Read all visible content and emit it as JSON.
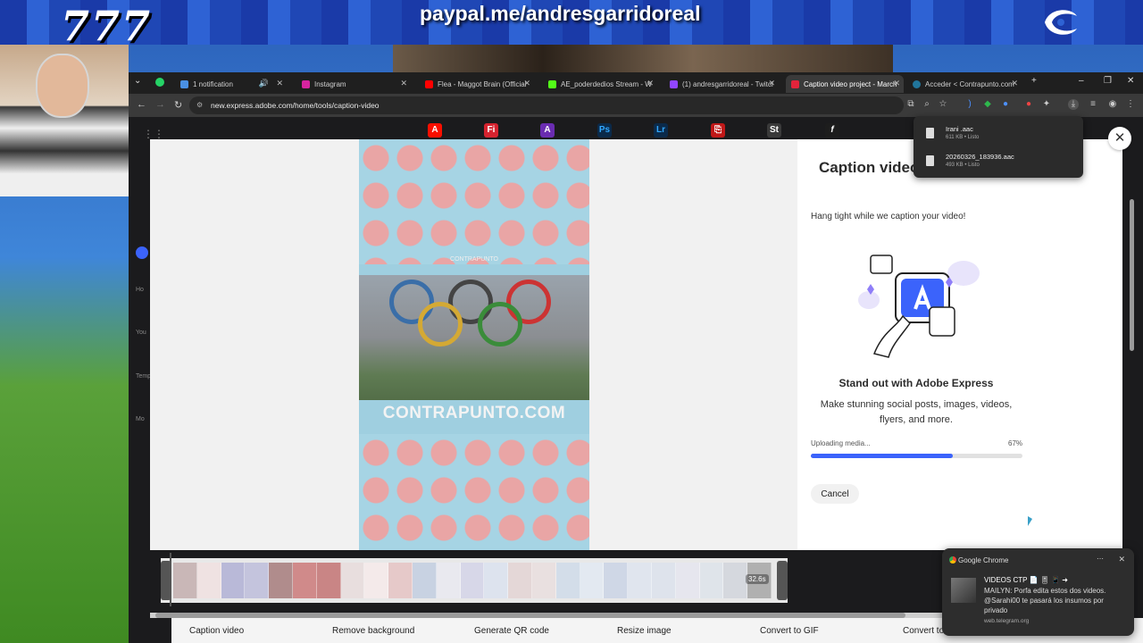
{
  "overlay": {
    "left_text": "777",
    "center_text": "paypal.me/andresgarridoreal"
  },
  "browser": {
    "tabs": [
      {
        "label": "1 notification",
        "fav": "#4a90e2"
      },
      {
        "label": "Instagram",
        "fav": "#d6249f"
      },
      {
        "label": "Flea - Maggot Brain (Official V",
        "fav": "#ff0000"
      },
      {
        "label": "AE_poderdedios Stream - Wa",
        "fav": "#53fc18"
      },
      {
        "label": "(1) andresgarridoreal - Twitch",
        "fav": "#9146ff"
      },
      {
        "label": "Caption video project - March",
        "fav": "#e2243b"
      },
      {
        "label": "Acceder < Contrapunto.com",
        "fav": "#21759b"
      }
    ],
    "url": "new.express.adobe.com/home/tools/caption-video"
  },
  "app_icons": [
    "Fi",
    "Ps",
    "Lr",
    "St",
    "f"
  ],
  "leftnav": [
    "Ho",
    "You",
    "Temp",
    "Mo"
  ],
  "video": {
    "brand_small": "CONTRAPUNTO",
    "brand_logo": "CONTRAPUNTO.COM"
  },
  "panel": {
    "title": "Caption video",
    "hang_tight": "Hang tight while we caption your video!",
    "headline": "Stand out with Adobe Express",
    "subtext": "Make stunning social posts, images, videos, flyers, and more.",
    "upload_label": "Uploading media...",
    "upload_pct_label": "67%",
    "upload_progress": 0.67,
    "cancel": "Cancel"
  },
  "timeline": {
    "duration": "32.6s"
  },
  "quick_actions": [
    "Caption video",
    "Remove background",
    "Generate QR code",
    "Resize image",
    "Convert to GIF",
    "Convert to"
  ],
  "downloads": [
    {
      "name": "Irani .aac",
      "meta": "611 KB • Listo"
    },
    {
      "name": "20260326_183936.aac",
      "meta": "493 KB • Listo"
    }
  ],
  "notification": {
    "app": "Google Chrome",
    "title": "VIDEOS CTP 📄 🎚 📱 ➜",
    "body": "MAILYN: Porfa edita estos dos videos. @Sarahi00 te pasará los insumos por privado",
    "source": "web.telegram.org"
  }
}
